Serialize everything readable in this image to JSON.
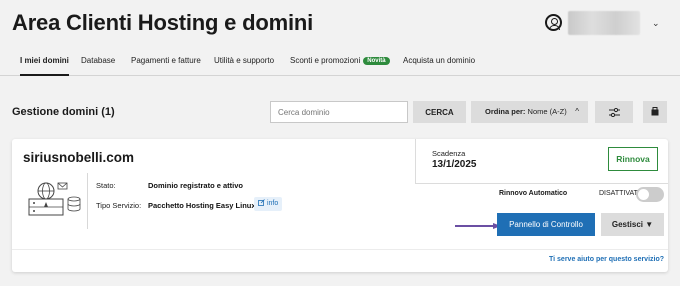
{
  "header": {
    "title": "Area Clienti Hosting e domini",
    "chevron": "⌄"
  },
  "tabs": [
    {
      "label": "I miei domini",
      "active": true
    },
    {
      "label": "Database"
    },
    {
      "label": "Pagamenti e fatture"
    },
    {
      "label": "Utilità e supporto"
    },
    {
      "label": "Sconti e promozioni",
      "badge": "Novità"
    },
    {
      "label": "Acquista un dominio"
    }
  ],
  "toolbar": {
    "section_title": "Gestione domini (1)",
    "search_placeholder": "Cerca dominio",
    "search_button": "CERCA",
    "order_prefix": "Ordina per:",
    "order_value": "Nome (A-Z)",
    "order_chevron": "^"
  },
  "domain": {
    "name": "siriusnobelli.com",
    "status_label": "Stato:",
    "status_value": "Dominio registrato e attivo",
    "service_label": "Tipo Servizio:",
    "service_value": "Pacchetto Hosting Easy Linux",
    "info_label": "info",
    "expiry_label": "Scadenza",
    "expiry_date": "13/1/2025",
    "renew_button": "Rinnova",
    "auto_renew_label": "Rinnovo Automatico",
    "auto_renew_status": "DISATTIVATO",
    "auto_renew_on": false,
    "control_panel_button": "Pannello di Controllo",
    "manage_button": "Gestisci ▼",
    "help_link": "Ti serve aiuto per questo servizio?"
  },
  "colors": {
    "accent_blue": "#1f6fb5",
    "green": "#2e8b3d",
    "arrow_purple": "#6b4fa3"
  }
}
